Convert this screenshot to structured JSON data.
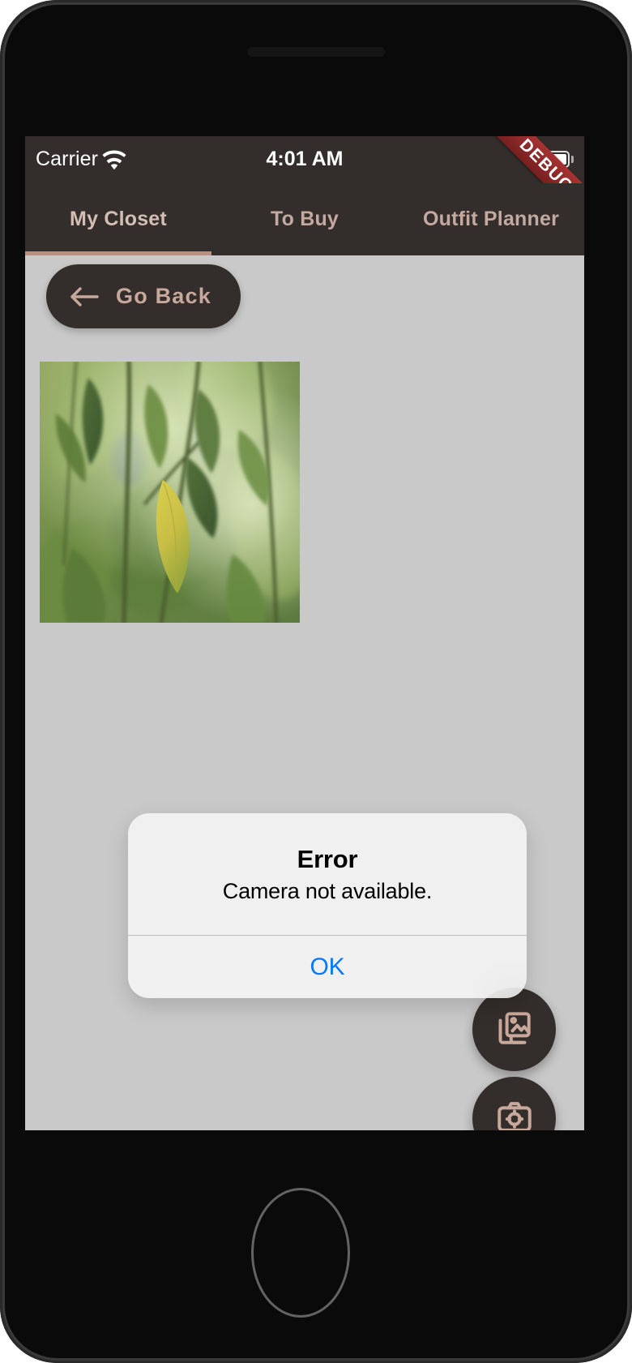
{
  "status_bar": {
    "carrier": "Carrier",
    "wifi_icon": "wifi-icon",
    "time": "4:01 AM",
    "battery_icon": "battery-full-icon"
  },
  "debug_banner": {
    "label": "DEBUG",
    "color": "#8d2a2a"
  },
  "tabs": [
    {
      "label": "My Closet",
      "active": true
    },
    {
      "label": "To Buy",
      "active": false
    },
    {
      "label": "Outfit Planner",
      "active": false
    }
  ],
  "toolbar": {
    "go_back_label": "Go Back",
    "go_back_icon": "arrow-left-icon"
  },
  "photo": {
    "alt": "green-willow-leaves-photo"
  },
  "alert": {
    "title": "Error",
    "message": "Camera not available.",
    "ok_label": "OK",
    "ok_color": "#007aff"
  },
  "fabs": [
    {
      "name": "gallery-fab",
      "icon": "photo-library-icon"
    },
    {
      "name": "camera-fab",
      "icon": "camera-target-icon"
    }
  ],
  "bottom_nav": [
    {
      "name": "messages",
      "icon": "chat-bubble-icon",
      "active": false
    },
    {
      "name": "home",
      "icon": "home-icon",
      "active": true
    },
    {
      "name": "profile",
      "icon": "account-circle-icon",
      "active": false
    }
  ],
  "theme": {
    "bar_background": "#332e2b",
    "accent": "#c9a89c",
    "screen_background": "#c9c9c9",
    "active_indicator": "#b98f80"
  }
}
